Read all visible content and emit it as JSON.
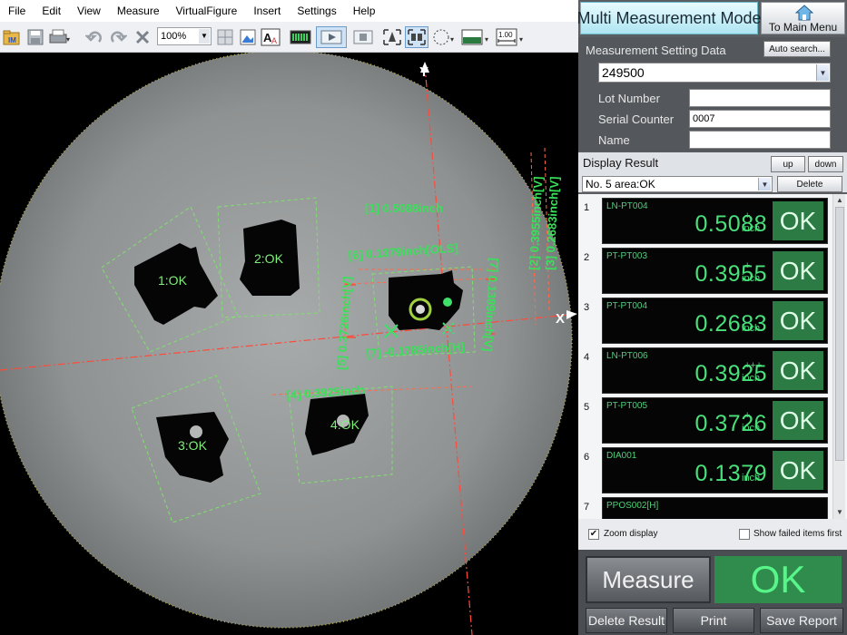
{
  "menu": [
    "File",
    "Edit",
    "View",
    "Measure",
    "VirtualFigure",
    "Insert",
    "Settings",
    "Help"
  ],
  "toolbar": {
    "zoom": "100%",
    "scale_label": "1.00"
  },
  "viewport": {
    "axis_x": "X",
    "axis_y": "Y",
    "parts": [
      "1:OK",
      "2:OK",
      "3:OK",
      "4:OK"
    ],
    "annotations": {
      "a1": "[1] 0.5088inch",
      "a6": "[6] 0.1379inch[OLS]",
      "a4": "[4] 0.3925inch",
      "a7h": "[7] -0.1785inch[H]",
      "a5": "[5] 0.3726inch[V]",
      "a2": "[2] 0.3955inch[V]",
      "a3": "[3] 0.2683inch[V]",
      "a7v": "[7] 0.1389inch[V]"
    }
  },
  "panel": {
    "mode_title": "Multi Measurement Mode",
    "main_menu_label": "To Main Menu",
    "setting_label": "Measurement Setting Data",
    "auto_search_label": "Auto search...",
    "setting_value": "249500",
    "lot_label": "Lot Number",
    "lot_value": "",
    "serial_label": "Serial Counter",
    "serial_value": "0007",
    "name_label": "Name",
    "name_value": "",
    "display_label": "Display Result",
    "up_label": "up",
    "down_label": "down",
    "result_select": "No. 5 area:OK",
    "delete_label": "Delete",
    "results": [
      {
        "num": "1",
        "name": "LN-PT004",
        "value": "0.5088",
        "unit": "inch",
        "tol": "+",
        "status": "OK"
      },
      {
        "num": "2",
        "name": "PT-PT003",
        "value": "0.3955",
        "unit": "inch",
        "tol": "+",
        "status": "OK"
      },
      {
        "num": "3",
        "name": "PT-PT004",
        "value": "0.2683",
        "unit": "inch",
        "tol": "",
        "status": "OK"
      },
      {
        "num": "4",
        "name": "LN-PT006",
        "value": "0.3925",
        "unit": "inch",
        "tol": "+++",
        "status": "OK"
      },
      {
        "num": "5",
        "name": "PT-PT005",
        "value": "0.3726",
        "unit": "inch",
        "tol": "+",
        "status": "OK"
      },
      {
        "num": "6",
        "name": "DIA001",
        "value": "0.1379",
        "unit": "inch",
        "tol": "",
        "status": "OK"
      },
      {
        "num": "7",
        "name": "PPOS002[H]",
        "value": "",
        "unit": "",
        "tol": "",
        "status": ""
      }
    ],
    "zoom_display_label": "Zoom display",
    "show_failed_label": "Show failed items first",
    "measure_label": "Measure",
    "overall_status": "OK",
    "delete_result_label": "Delete Result",
    "print_label": "Print",
    "save_report_label": "Save Report"
  },
  "colors": {
    "accent_green": "#49e07a",
    "ok_bg": "#2c7a44",
    "annotation_green": "#39e05a",
    "crosshair_red": "#ff4a3a"
  }
}
